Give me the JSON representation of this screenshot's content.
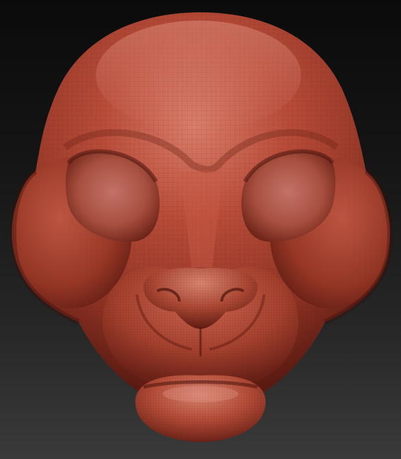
{
  "scene": {
    "subject": "sculpted-animal-head-mask",
    "colors": {
      "background_top": "#0b0b0b",
      "background_bottom": "#3a3a3a",
      "clay_base": "#a8402f",
      "clay_highlight": "#d77a68",
      "clay_shadow": "#5a1a12",
      "wire_line": "#7a2a1e"
    }
  }
}
